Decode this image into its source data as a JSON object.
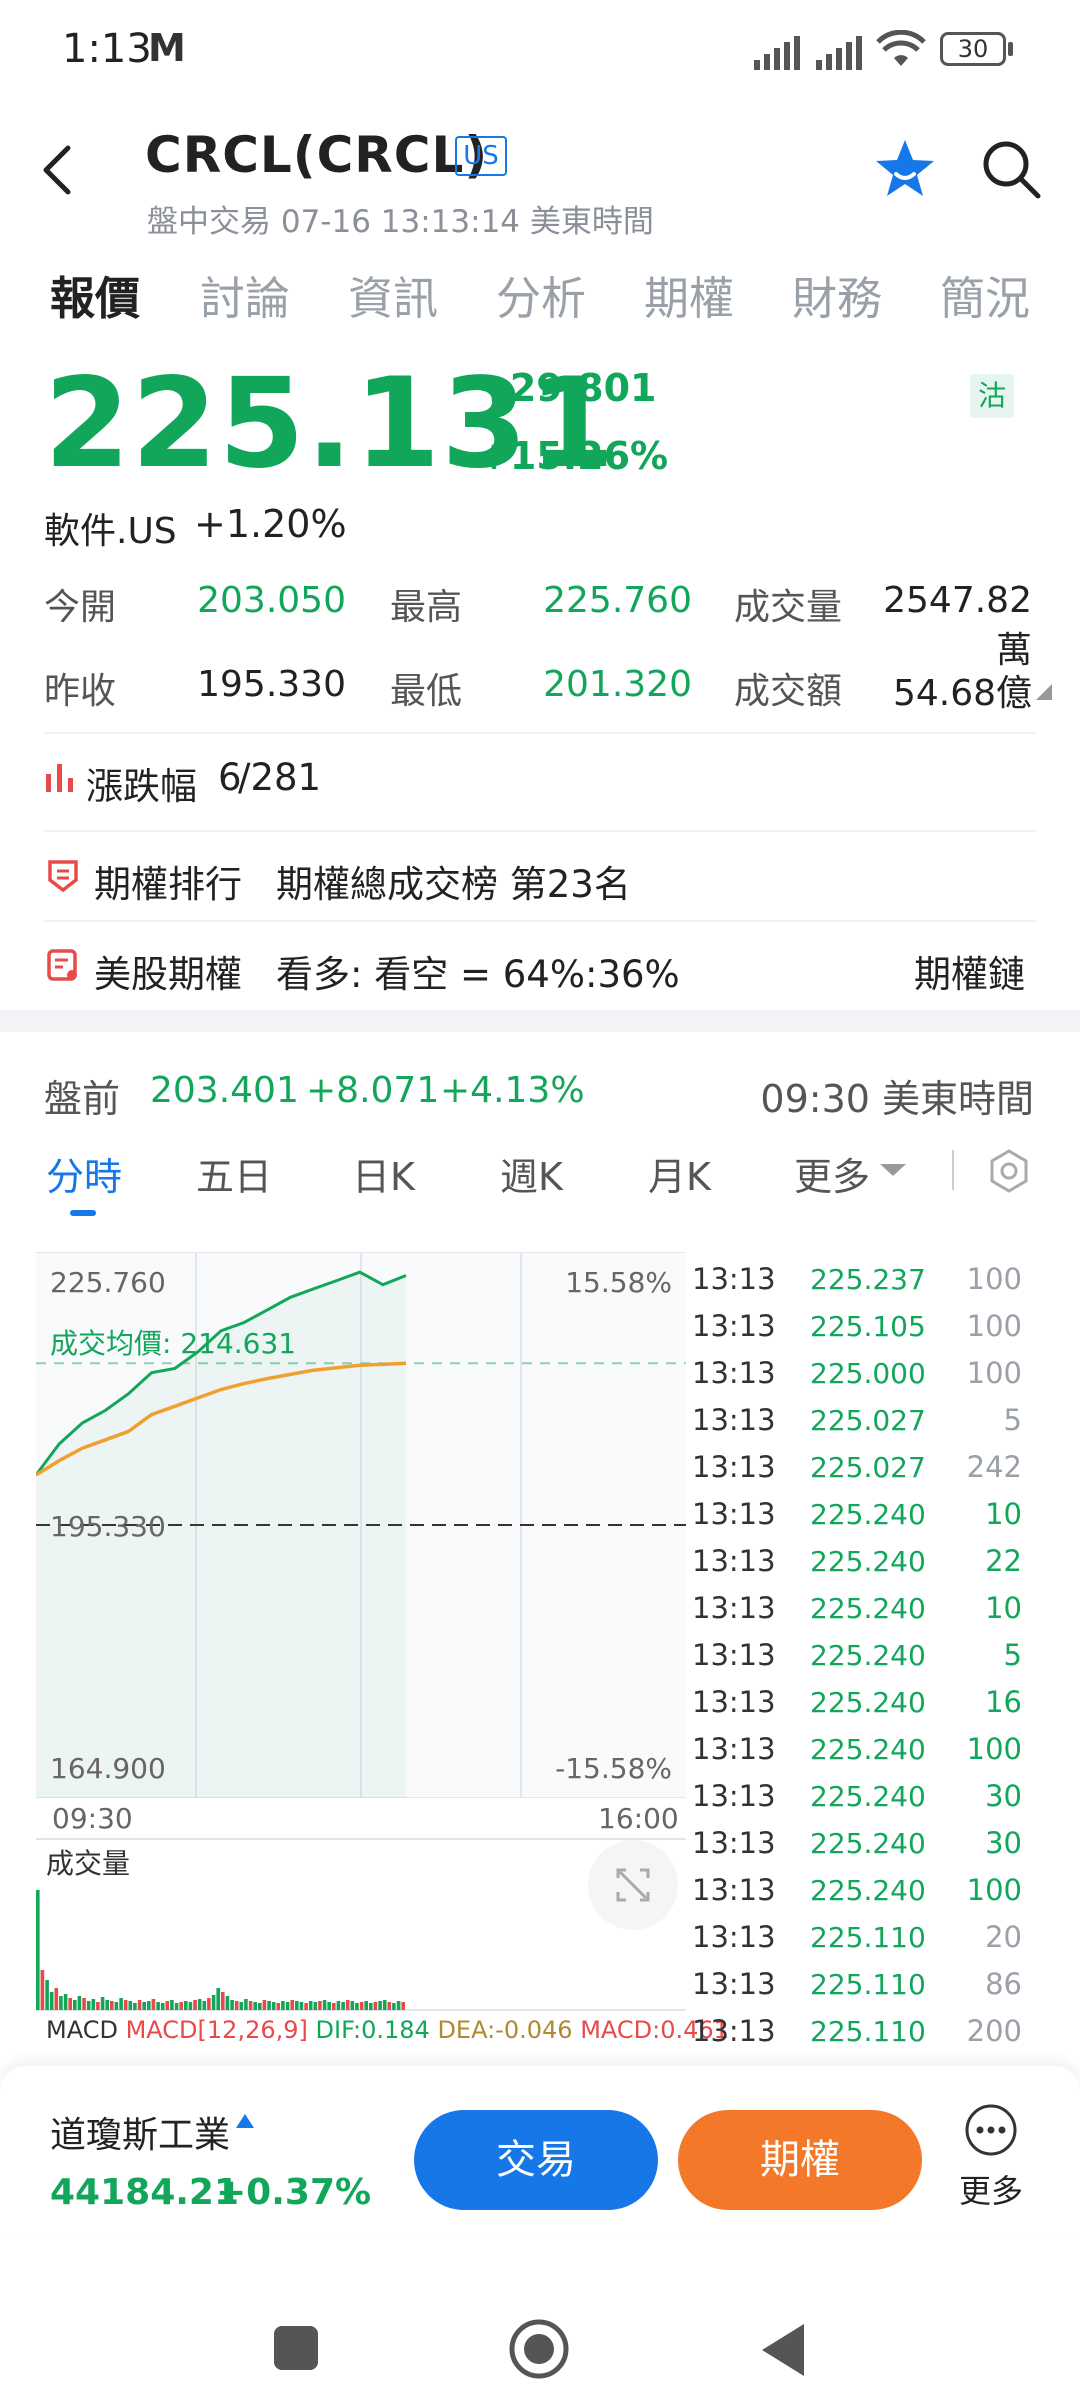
{
  "status_bar": {
    "time": "1:13",
    "mail_icon": "M",
    "battery": "30"
  },
  "header": {
    "title": "CRCL(CRCL)",
    "market_badge": "US",
    "subtitle": "盤中交易 07-16 13:13:14 美東時間"
  },
  "tabs": [
    {
      "label": "報價",
      "active": true
    },
    {
      "label": "討論"
    },
    {
      "label": "資訊"
    },
    {
      "label": "分析"
    },
    {
      "label": "期權"
    },
    {
      "label": "財務"
    },
    {
      "label": "簡況"
    }
  ],
  "quote": {
    "price": "225.131",
    "change": "+29.801",
    "change_pct": "+15.26%",
    "margin_badge": "沽",
    "sector_name": "軟件.US",
    "sector_change": "+1.20%"
  },
  "stats": {
    "open_label": "今開",
    "open_value": "203.050",
    "high_label": "最高",
    "high_value": "225.760",
    "volume_label": "成交量",
    "volume_value": "2547.82萬",
    "prev_close_label": "昨收",
    "prev_close_value": "195.330",
    "low_label": "最低",
    "low_value": "201.320",
    "turnover_label": "成交額",
    "turnover_value": "54.68億"
  },
  "info_rows": {
    "updown_label": "漲跌幅",
    "updown_up": "6",
    "updown_total": "/281",
    "option_rank_label": "期權排行",
    "option_rank_value": "期權總成交榜 第23名",
    "us_options_label": "美股期權",
    "us_options_value": "看多: 看空 = 64%:36%",
    "options_chain_link": "期權鏈"
  },
  "premarket": {
    "label": "盤前",
    "price": "203.401",
    "change": "+8.071",
    "change_pct": "+4.13%",
    "time": "09:30 美東時間"
  },
  "chart_tabs": [
    {
      "label": "分時",
      "active": true
    },
    {
      "label": "五日"
    },
    {
      "label": "日K"
    },
    {
      "label": "週K"
    },
    {
      "label": "月K"
    },
    {
      "label": "更多"
    }
  ],
  "chart": {
    "y_high": "225.760",
    "y_high_pct": "15.58%",
    "avg_price_label": "成交均價: 214.631",
    "prev_close": "195.330",
    "y_low": "164.900",
    "y_low_pct": "-15.58%",
    "x_start": "09:30",
    "x_end": "16:00",
    "volume_label": "成交量",
    "macd_label": "MACD",
    "macd_params": "MACD[12,26,9]",
    "dif": "DIF:0.184",
    "dea": "DEA:-0.046",
    "macd_val": "MACD:0.461",
    "colors": {
      "price_line": "#12a65a",
      "avg_line": "#f0a030",
      "up": "#12a65a",
      "down": "#e84a4a"
    }
  },
  "chart_data": {
    "type": "line",
    "x_range": [
      "09:30",
      "16:00"
    ],
    "ylim": [
      164.9,
      225.76
    ],
    "reference_line": 195.33,
    "series": [
      {
        "values": [
          201.3,
          205.0,
          207.5,
          209.0,
          211.0,
          213.5,
          214.0,
          216.0,
          218.5,
          219.5,
          221.0,
          222.5,
          223.5,
          224.5,
          225.5,
          224.0,
          225.1
        ]
      },
      {
        "values": [
          201.3,
          203.0,
          204.5,
          205.5,
          206.5,
          208.5,
          209.5,
          210.5,
          211.5,
          212.2,
          212.8,
          213.3,
          213.8,
          214.1,
          214.4,
          214.5,
          214.631
        ]
      }
    ]
  },
  "ticks": [
    {
      "time": "13:13",
      "price": "225.237",
      "vol": "100",
      "vol_color": "gray"
    },
    {
      "time": "13:13",
      "price": "225.105",
      "vol": "100",
      "vol_color": "gray"
    },
    {
      "time": "13:13",
      "price": "225.000",
      "vol": "100",
      "vol_color": "gray"
    },
    {
      "time": "13:13",
      "price": "225.027",
      "vol": "5",
      "vol_color": "gray"
    },
    {
      "time": "13:13",
      "price": "225.027",
      "vol": "242",
      "vol_color": "gray"
    },
    {
      "time": "13:13",
      "price": "225.240",
      "vol": "10",
      "vol_color": "green"
    },
    {
      "time": "13:13",
      "price": "225.240",
      "vol": "22",
      "vol_color": "green"
    },
    {
      "time": "13:13",
      "price": "225.240",
      "vol": "10",
      "vol_color": "green"
    },
    {
      "time": "13:13",
      "price": "225.240",
      "vol": "5",
      "vol_color": "green"
    },
    {
      "time": "13:13",
      "price": "225.240",
      "vol": "16",
      "vol_color": "green"
    },
    {
      "time": "13:13",
      "price": "225.240",
      "vol": "100",
      "vol_color": "green"
    },
    {
      "time": "13:13",
      "price": "225.240",
      "vol": "30",
      "vol_color": "green"
    },
    {
      "time": "13:13",
      "price": "225.240",
      "vol": "30",
      "vol_color": "green"
    },
    {
      "time": "13:13",
      "price": "225.240",
      "vol": "100",
      "vol_color": "green"
    },
    {
      "time": "13:13",
      "price": "225.110",
      "vol": "20",
      "vol_color": "gray"
    },
    {
      "time": "13:13",
      "price": "225.110",
      "vol": "86",
      "vol_color": "gray"
    },
    {
      "time": "13:13",
      "price": "225.110",
      "vol": "200",
      "vol_color": "gray"
    }
  ],
  "bottom_bar": {
    "index_name": "道瓊斯工業",
    "index_value": "44184.21",
    "index_change": "+0.37%",
    "trade_label": "交易",
    "options_label": "期權",
    "more_label": "更多"
  }
}
